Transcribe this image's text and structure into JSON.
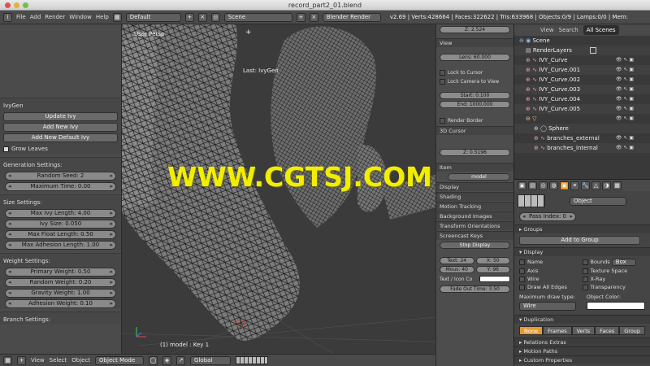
{
  "window": {
    "title": "record_part2_01.blend"
  },
  "topbar": {
    "menus": [
      "File",
      "Add",
      "Render",
      "Window",
      "Help"
    ],
    "layout": "Default",
    "scene": "Scene",
    "engine": "Blender Render",
    "stats": "v2.69 | Verts:428664 | Faces:322622 | Tris:633968 | Objects:0/9 | Lamps:0/0 | Mem:"
  },
  "left_panel": {
    "title": "IvyGen",
    "update": "Update Ivy",
    "add_new": "Add New Ivy",
    "add_default": "Add New Default Ivy",
    "grow_leaves": "Grow Leaves",
    "generation": {
      "title": "Generation Settings:",
      "seed": "Random Seed: 2",
      "max_time": "Maximum Time: 0.00"
    },
    "size": {
      "title": "Size Settings:",
      "max_len": "Max Ivy Length: 4.00",
      "ivy_size": "Ivy Size: 0.050",
      "float_len": "Max Float Length: 0.50",
      "adhesion_len": "Max Adhesion Length: 1.00"
    },
    "weight": {
      "title": "Weight Settings:",
      "primary": "Primary Weight: 0.50",
      "random": "Random Weight: 0.20",
      "gravity": "Gravity Weight: 1.00",
      "adhesion": "Adhesion Weight: 0.10"
    },
    "branch": {
      "title": "Branch Settings:"
    }
  },
  "viewport": {
    "view_label": "User Persp",
    "last_op": "Last: IvyGen",
    "status": "(1) model : Key 1",
    "watermark": "WWW.CGTSJ.COM"
  },
  "n_panel": {
    "z_top": "Z: 2.524",
    "view": "View",
    "lens": "Lens: 60.000",
    "lock_cursor": "Lock to Cursor",
    "lock_camera": "Lock Camera to View",
    "start": "Start: 0.100",
    "end": "End: 1000.000",
    "render_border": "Render Border",
    "cursor_header": "3D Cursor",
    "cursor_z": "Z: 0.5196",
    "item": "Item",
    "item_name": "model",
    "display": "Display",
    "shading": "Shading",
    "motion": "Motion Tracking",
    "background": "Background Images",
    "transform": "Transform Orientations",
    "screencast": "Screencast Keys",
    "stop": "Stop Display",
    "text_val": "Text: 24",
    "x_val": "X: 50",
    "mouse_val": "Mous: 40",
    "y_val": "Y: 96",
    "text_icon": "Text / Icon Co",
    "fade": "Fade Out Time: 3.50"
  },
  "outliner": {
    "tabs": [
      "View",
      "Search",
      "All Scenes"
    ],
    "rows": [
      "Scene",
      "RenderLayers",
      "IVY_Curve",
      "IVY_Curve.001",
      "IVY_Curve.002",
      "IVY_Curve.003",
      "IVY_Curve.004",
      "IVY_Curve.005",
      "",
      "Sphere",
      "branches_external",
      "branches_internal"
    ]
  },
  "properties": {
    "pass_index": "Pass Index: 0",
    "object_field": "Object",
    "groups": "Groups",
    "add_group": "Add to Group",
    "display": "Display",
    "opts": [
      "Name",
      "Bounds",
      "Box",
      "Axis",
      "Texture Space",
      "Wire",
      "X-Ray",
      "Draw All Edges",
      "Transparency"
    ],
    "max_draw": "Maximum draw type:",
    "obj_color": "Object Color:",
    "wire_val": "Wire",
    "duplication": "Duplication",
    "dup_tabs": [
      "None",
      "Frames",
      "Verts",
      "Faces",
      "Group"
    ],
    "relations": "Relations Extras",
    "motion_paths": "Motion Paths",
    "custom_props": "Custom Properties"
  },
  "bottombar": {
    "items": [
      "View",
      "Select",
      "Object"
    ],
    "mode": "Object Mode",
    "orientation": "Global"
  }
}
